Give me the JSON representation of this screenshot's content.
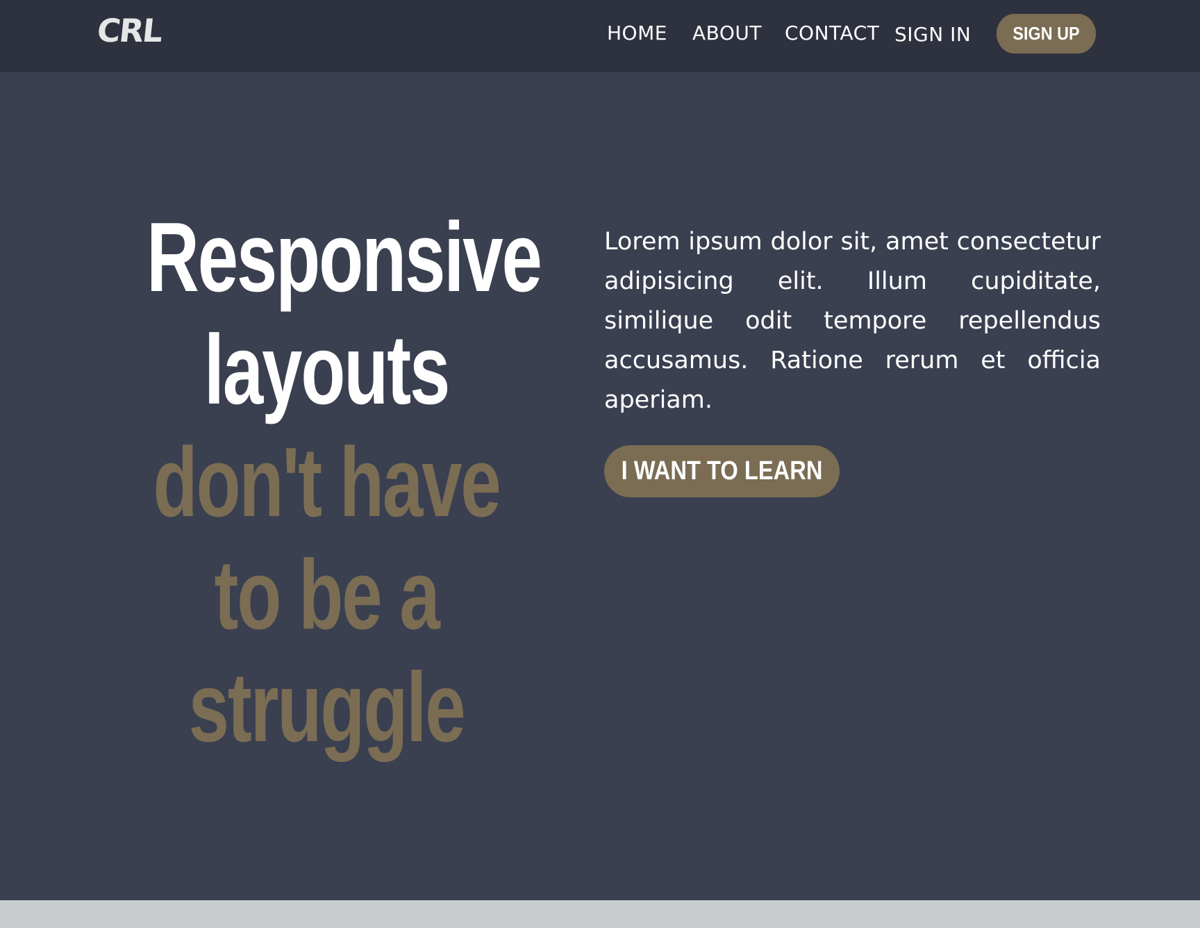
{
  "header": {
    "logo": "CRL",
    "nav": {
      "home": "HOME",
      "about": "ABOUT",
      "contact": "CONTACT",
      "signin": "SIGN IN"
    },
    "signup_label": "SIGN UP"
  },
  "hero": {
    "title_lines": [
      "Responsive",
      "layouts",
      "don't have",
      "to be a",
      "struggle"
    ],
    "paragraph": "Lorem ipsum dolor sit, amet consectetur adipisicing elit. Illum cupiditate, similique odit tempore repellendus accusamus. Ratione rerum et officia aperiam.",
    "cta_label": "I WANT TO LEARN"
  },
  "colors": {
    "header_bg": "#2e313e",
    "page_bg": "#3b4051",
    "accent": "#7a6d54",
    "footer_strip": "#c9ccce",
    "text": "#ffffff"
  }
}
